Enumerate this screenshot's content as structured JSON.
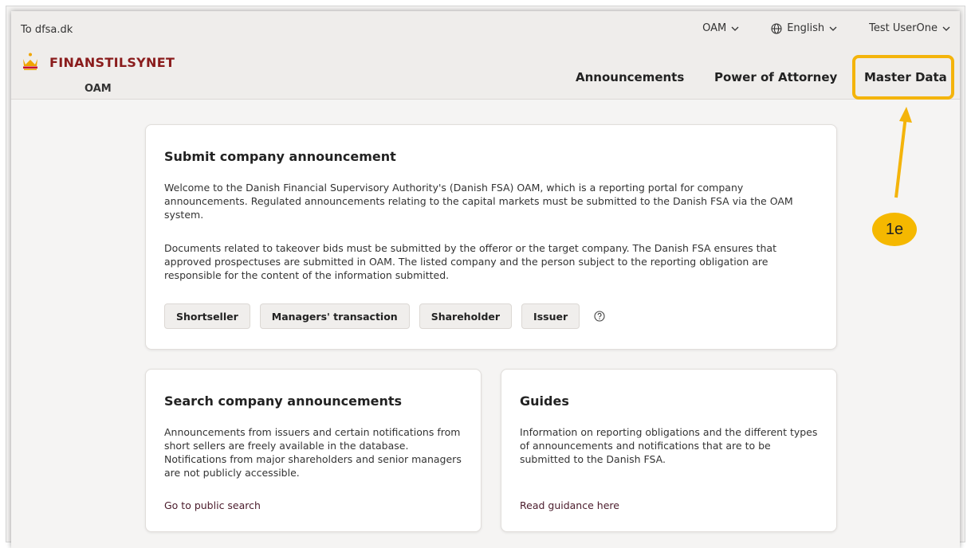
{
  "header": {
    "to_link": "To dfsa.dk",
    "top_menu": {
      "oam": "OAM",
      "language": "English",
      "user": "Test UserOne"
    },
    "brand": {
      "name": "FINANSTILSYNET",
      "sub": "OAM"
    },
    "nav": {
      "announcements": "Announcements",
      "power_of_attorney": "Power of Attorney",
      "master_data": "Master Data"
    }
  },
  "submit_card": {
    "title": "Submit company announcement",
    "paragraph1": "Welcome to the Danish Financial Supervisory Authority's (Danish FSA) OAM, which is a reporting portal for company announcements. Regulated announcements relating to the capital markets must be submitted to the Danish FSA via the OAM system.",
    "paragraph2": "Documents related to takeover bids must be submitted by the offeror or the target company. The Danish FSA ensures that approved prospectuses are submitted in OAM. The listed company and the person subject to the reporting obligation are responsible for the content of the information submitted.",
    "buttons": {
      "shortseller": "Shortseller",
      "managers_transaction": "Managers' transaction",
      "shareholder": "Shareholder",
      "issuer": "Issuer"
    }
  },
  "search_card": {
    "title": "Search company announcements",
    "text": "Announcements from issuers and certain notifications from short sellers are freely available in the database. Notifications from major shareholders and senior managers are not publicly accessible.",
    "link": "Go to public search"
  },
  "guides_card": {
    "title": "Guides",
    "text": "Information on reporting obligations and the different types of announcements and notifications that are to be submitted to the Danish FSA.",
    "link": "Read guidance here"
  },
  "annotation": {
    "label": "1e"
  },
  "colors": {
    "brand": "#8a1c1c",
    "highlight": "#f4b40b",
    "link": "#4a1b2b"
  }
}
